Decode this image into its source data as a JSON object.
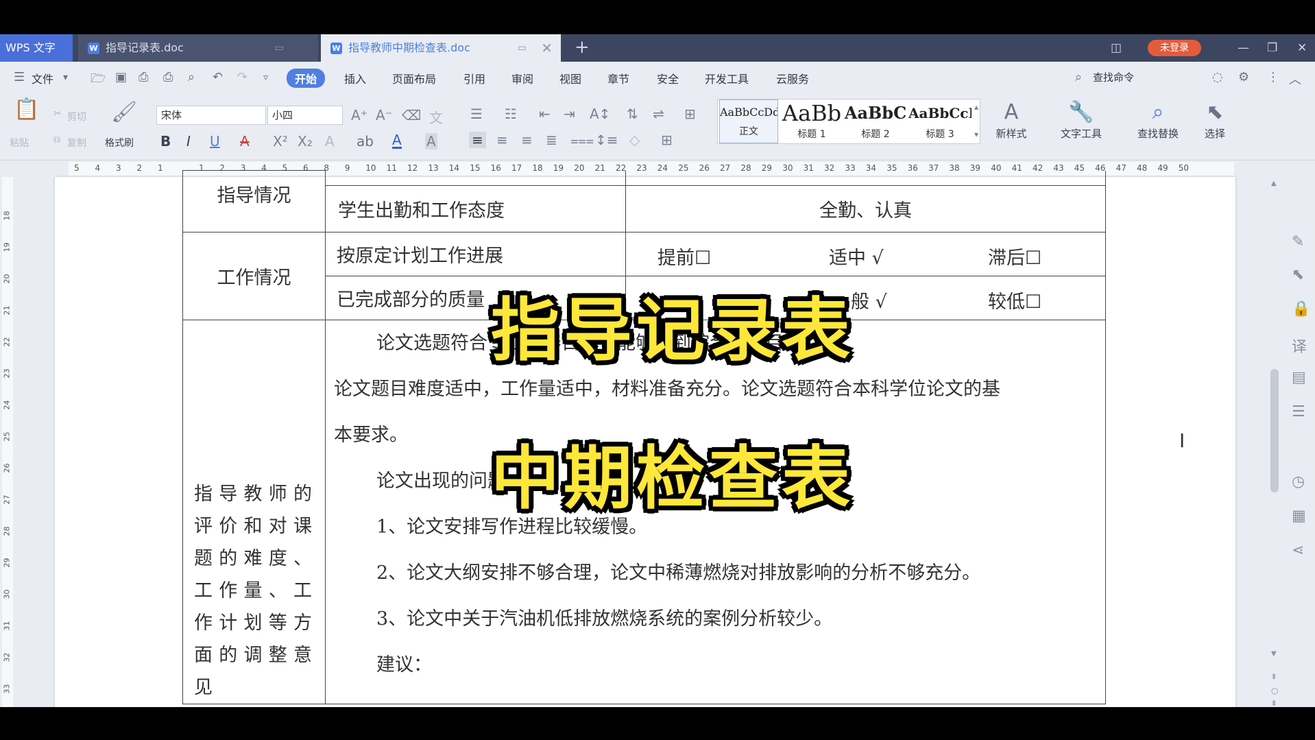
{
  "app": {
    "brand": "WPS 文字",
    "tabs": [
      {
        "label": "指导记录表.doc",
        "active": false
      },
      {
        "label": "指导教师中期检查表.doc",
        "active": true
      }
    ],
    "login": "未登录"
  },
  "menu": {
    "file": "文件",
    "items": [
      "开始",
      "插入",
      "页面布局",
      "引用",
      "审阅",
      "视图",
      "章节",
      "安全",
      "开发工具",
      "云服务"
    ],
    "active": "开始",
    "search": "查找命令"
  },
  "ribbon": {
    "paste": "粘贴",
    "cut": "剪切",
    "copy": "复制",
    "format_painter": "格式刷",
    "font_name": "宋体",
    "font_size": "小四",
    "styles": [
      {
        "sample": "AaBbCcDd",
        "label": "正文"
      },
      {
        "sample": "AaBb",
        "label": "标题 1"
      },
      {
        "sample": "AaBbC",
        "label": "标题 2"
      },
      {
        "sample": "AaBbCcI",
        "label": "标题 3"
      }
    ],
    "new_style": "新样式",
    "text_tools": "文字工具",
    "find_replace": "查找替换",
    "select": "选择"
  },
  "ruler": {
    "left": [
      "5",
      "4",
      "3",
      "2",
      "1"
    ],
    "right": [
      "1",
      "2",
      "3",
      "4",
      "5",
      "6",
      "8",
      "9",
      "10",
      "11",
      "12",
      "13",
      "14",
      "15",
      "16",
      "17",
      "18",
      "19",
      "20",
      "21",
      "22",
      "23",
      "24",
      "25",
      "26",
      "27",
      "28",
      "29",
      "30",
      "31",
      "32",
      "33",
      "34",
      "35",
      "36",
      "37",
      "38",
      "39",
      "40",
      "41",
      "42",
      "43",
      "45",
      "46",
      "47",
      "48",
      "49",
      "50"
    ],
    "vertical": [
      "18",
      "19",
      "20",
      "21",
      "22",
      "23",
      "24",
      "25",
      "26",
      "27",
      "28",
      "29",
      "30",
      "31",
      "32",
      "33"
    ]
  },
  "document": {
    "row_guidance_head": "指导情况",
    "attendance_label": "学生出勤和工作态度",
    "attendance_value": "全勤、认真",
    "work_head": "工作情况",
    "progress_label": "按原定计划工作进展",
    "progress_opts": [
      "提前☐",
      "适中 √",
      "滞后☐"
    ],
    "quality_label": "已完成部分的质量",
    "quality_opts": [
      "般 √",
      "较低☐"
    ],
    "eval_head": "指导教师的评价和对课题的难度、工作量、工作计划等方面的调整意见",
    "eval_lines": [
      "论文选题符合专业培养目标，能够达到综合训练目的。本",
      "论文题目难度适中，工作量适中，材料准备充分。论文选题符合本科学位论文的基",
      "本要求。",
      "论文出现的问题：",
      "1、论文安排写作进程比较缓慢。",
      "2、论文大纲安排不够合理，论文中稀薄燃烧对排放影响的分析不够充分。",
      "3、论文中关于汽油机低排放燃烧系统的案例分析较少。",
      "建议："
    ]
  },
  "overlay": {
    "title1": "指导记录表",
    "title2": "中期检查表"
  }
}
